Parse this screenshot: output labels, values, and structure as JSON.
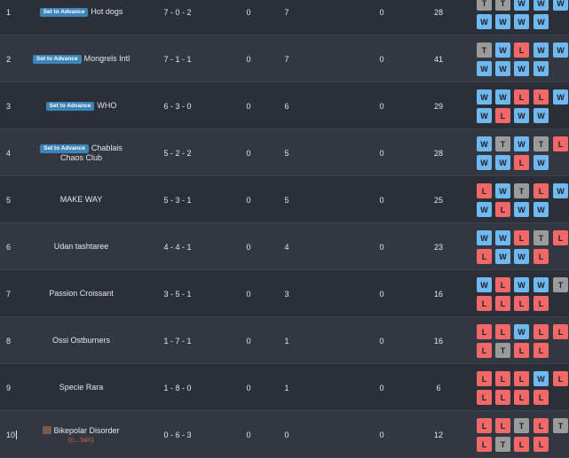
{
  "advance_label": "Set to Advance",
  "rows": [
    {
      "rank": "1",
      "team": "Hot dogs",
      "advance": true,
      "record": "7 - 0 - 2",
      "c1": "0",
      "c2": "7",
      "c3": "0",
      "c4": "28",
      "form": [
        "T",
        "T",
        "W",
        "W",
        "W",
        "W",
        "W",
        "W",
        "W"
      ]
    },
    {
      "rank": "2",
      "team": "Mongrels Intl",
      "advance": true,
      "record": "7 - 1 - 1",
      "c1": "0",
      "c2": "7",
      "c3": "0",
      "c4": "41",
      "form": [
        "T",
        "W",
        "L",
        "W",
        "W",
        "W",
        "W",
        "W",
        "W"
      ]
    },
    {
      "rank": "3",
      "team": "WHO",
      "advance": true,
      "record": "6 - 3 - 0",
      "c1": "0",
      "c2": "6",
      "c3": "0",
      "c4": "29",
      "form": [
        "W",
        "W",
        "L",
        "L",
        "W",
        "W",
        "L",
        "W",
        "W"
      ]
    },
    {
      "rank": "4",
      "team": "Chablais Chaos Club",
      "advance": true,
      "record": "5 - 2 - 2",
      "c1": "0",
      "c2": "5",
      "c3": "0",
      "c4": "28",
      "form": [
        "W",
        "T",
        "W",
        "T",
        "L",
        "W",
        "W",
        "L",
        "W"
      ]
    },
    {
      "rank": "5",
      "team": "MAKE WAY",
      "advance": false,
      "record": "5 - 3 - 1",
      "c1": "0",
      "c2": "5",
      "c3": "0",
      "c4": "25",
      "form": [
        "L",
        "W",
        "T",
        "L",
        "W",
        "W",
        "L",
        "W",
        "W"
      ]
    },
    {
      "rank": "6",
      "team": "Udan tashtaree",
      "advance": false,
      "record": "4 - 4 - 1",
      "c1": "0",
      "c2": "4",
      "c3": "0",
      "c4": "23",
      "form": [
        "W",
        "W",
        "L",
        "T",
        "L",
        "L",
        "W",
        "W",
        "L"
      ]
    },
    {
      "rank": "7",
      "team": "Passion Croissant",
      "advance": false,
      "record": "3 - 5 - 1",
      "c1": "0",
      "c2": "3",
      "c3": "0",
      "c4": "16",
      "form": [
        "W",
        "L",
        "W",
        "W",
        "T",
        "L",
        "L",
        "L",
        "L"
      ]
    },
    {
      "rank": "8",
      "team": "Ossi Ostburners",
      "advance": false,
      "record": "1 - 7 - 1",
      "c1": "0",
      "c2": "1",
      "c3": "0",
      "c4": "16",
      "form": [
        "L",
        "L",
        "W",
        "L",
        "L",
        "L",
        "T",
        "L",
        "L"
      ]
    },
    {
      "rank": "9",
      "team": "Specie Rara",
      "advance": false,
      "record": "1 - 8 - 0",
      "c1": "0",
      "c2": "1",
      "c3": "0",
      "c4": "6",
      "form": [
        "L",
        "L",
        "L",
        "W",
        "L",
        "L",
        "L",
        "L",
        "L"
      ]
    },
    {
      "rank": "10",
      "team": "Bikepolar Disorder",
      "advance": false,
      "avatar": true,
      "flair": "(c...tain)",
      "record": "0 - 6 - 3",
      "c1": "0",
      "c2": "0",
      "c3": "0",
      "c4": "12",
      "form": [
        "L",
        "L",
        "T",
        "L",
        "T",
        "L",
        "T",
        "L",
        "L"
      ]
    }
  ]
}
